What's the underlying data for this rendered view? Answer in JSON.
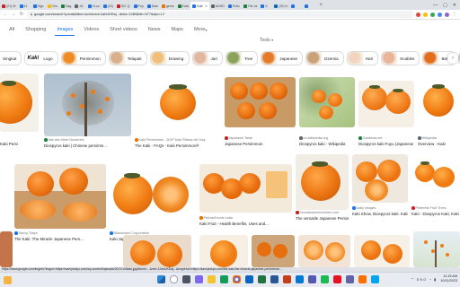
{
  "browser": {
    "tabs": [
      {
        "label": "(21) W",
        "color": "#c5221f"
      },
      {
        "label": "41",
        "color": "#1a73e8"
      },
      {
        "label": "Sign",
        "color": "#1a73e8"
      },
      {
        "label": "Cho",
        "color": "#fbbc04"
      },
      {
        "label": "Dag",
        "color": "#188038"
      },
      {
        "label": "JA",
        "color": "#5f6368"
      },
      {
        "label": "hi.so",
        "color": "#1a73e8"
      },
      {
        "label": "(22)",
        "color": "#1a73e8"
      },
      {
        "label": "SIC Q",
        "color": "#c5221f"
      },
      {
        "label": "Pop",
        "color": "#1a73e8"
      },
      {
        "label": "Dian",
        "color": "#1a73e8"
      },
      {
        "label": "gems",
        "color": "#e37400"
      },
      {
        "label": "Exist",
        "color": "#188038"
      },
      {
        "label": "Kaki",
        "color": "#1a73e8",
        "active": true
      },
      {
        "label": "ADHD",
        "color": "#5f6368"
      },
      {
        "label": "Pollo",
        "color": "#1a73e8"
      },
      {
        "label": "The Ja",
        "color": "#188038"
      },
      {
        "label": "S",
        "color": "#1a73e8"
      },
      {
        "label": "(20) In",
        "color": "#0a66c2"
      },
      {
        "label": "",
        "color": "#1a73e8"
      },
      {
        "label": "",
        "color": "#1a73e8"
      }
    ],
    "url": "google.com/search?q=kaki&tbm=isch&ved=2ahUKEwj...&biw=1280&bih=577&dpr=1.5"
  },
  "search_tabs": [
    {
      "label": "All",
      "selected": false
    },
    {
      "label": "Shopping",
      "selected": false
    },
    {
      "label": "Images",
      "selected": true
    },
    {
      "label": "Videos",
      "selected": false
    },
    {
      "label": "Short videos",
      "selected": false
    },
    {
      "label": "News",
      "selected": false
    },
    {
      "label": "Maps",
      "selected": false
    },
    {
      "label": "More",
      "selected": false
    }
  ],
  "tools_label": "Tools",
  "chips": [
    {
      "label": "Singkat",
      "thumb": "#e8711f",
      "cut": true
    },
    {
      "label": "Logo",
      "thumb": "#ffffff",
      "logo_text": "Kaki"
    },
    {
      "label": "Persimmon",
      "thumb": "#f08a24"
    },
    {
      "label": "Telapak",
      "thumb": "#d9b08c"
    },
    {
      "label": "Drawing",
      "thumb": "#f0c07a"
    },
    {
      "label": "Jari",
      "thumb": "#e2b7a0"
    },
    {
      "label": "Tree",
      "thumb": "#8aa35a"
    },
    {
      "label": "Japanese",
      "thumb": "#e47b2a"
    },
    {
      "label": "Dzemia",
      "thumb": "#c9a27a"
    },
    {
      "label": "Hari",
      "thumb": "#f3d5bf"
    },
    {
      "label": "Scables",
      "thumb": "#e8b49a"
    },
    {
      "label": "Bets",
      "thumb": "#e46d1c"
    },
    {
      "label": "Bird",
      "thumb": "#7a8d6a"
    }
  ],
  "results": [
    {
      "source": "",
      "title": "Kaki Persi",
      "src_color": "#e37400"
    },
    {
      "source": "Van den Berk Nurseries",
      "title": "Diospyros kaki | Chinese persimm...",
      "src_color": "#188038"
    },
    {
      "source": "Kaki Persimmon - DOP Kaki Ribera del Xúq...",
      "title": "The Kaki - FAQs - Kaki Persimmon®",
      "src_color": "#e37400"
    },
    {
      "source": "Japanese Taste",
      "title": "Japanese Persimmon",
      "src_color": "#c5221f"
    },
    {
      "source": "en.wikipedia.org",
      "title": "Diospyros kaki - Wikipedia",
      "src_color": "#5f6368"
    },
    {
      "source": "Gardenia.net",
      "title": "Diospyros kaki Fuyu (Japanese ...",
      "src_color": "#188038"
    },
    {
      "source": "Wikipedia",
      "title": "Overview - Kaki",
      "src_color": "#5f6368"
    },
    {
      "source": "Savvy Tokyo",
      "title": "The Kaki: The Miracle Japanese Pers...",
      "src_color": "#1a73e8"
    },
    {
      "source": "Nikkonians Corporation",
      "title": "Kaki Japanese Persimmon | Kikkom...",
      "src_color": "#1a73e8"
    },
    {
      "source": "PeKatoFoods India",
      "title": "Kaki Fruit - Health Benefits, Uses and...",
      "src_color": "#e37400"
    },
    {
      "source": "mmodestsoforbidden.com",
      "title": "The versatile Japanese Persim...",
      "src_color": "#c5221f"
    },
    {
      "source": "Daily Images",
      "title": "Kaki Show, Diospyros kaki. Kaki Wl...",
      "src_color": "#1a73e8"
    },
    {
      "source": "Pinterest Fruit Trees",
      "title": "Kaki - Diospyros Kaki, Kaki Ribera...",
      "src_color": "#c5221f"
    },
    {
      "source": "DW",
      "title": "Kaki",
      "src_color": "#1a73e8"
    }
  ],
  "status_url": "https://www.google.com/imgres?imgurl=https://savvytokyo.com/wp-content/uploads/2021/10/kaki.jpg&tbnid=...&vet=12ahUKEwj...&imgrefurl=https://savvytokyo.com/the-kaki-the-miracle-japanese-persimmon...",
  "taskbar": {
    "time": "11:15 AM",
    "date": "10/11/2023",
    "tray": "ENG"
  },
  "colors": {
    "accent": "#1a73e8",
    "persimmon": "#f07b12",
    "persimmon_dark": "#d9560b",
    "leaf": "#4e5a2a"
  }
}
